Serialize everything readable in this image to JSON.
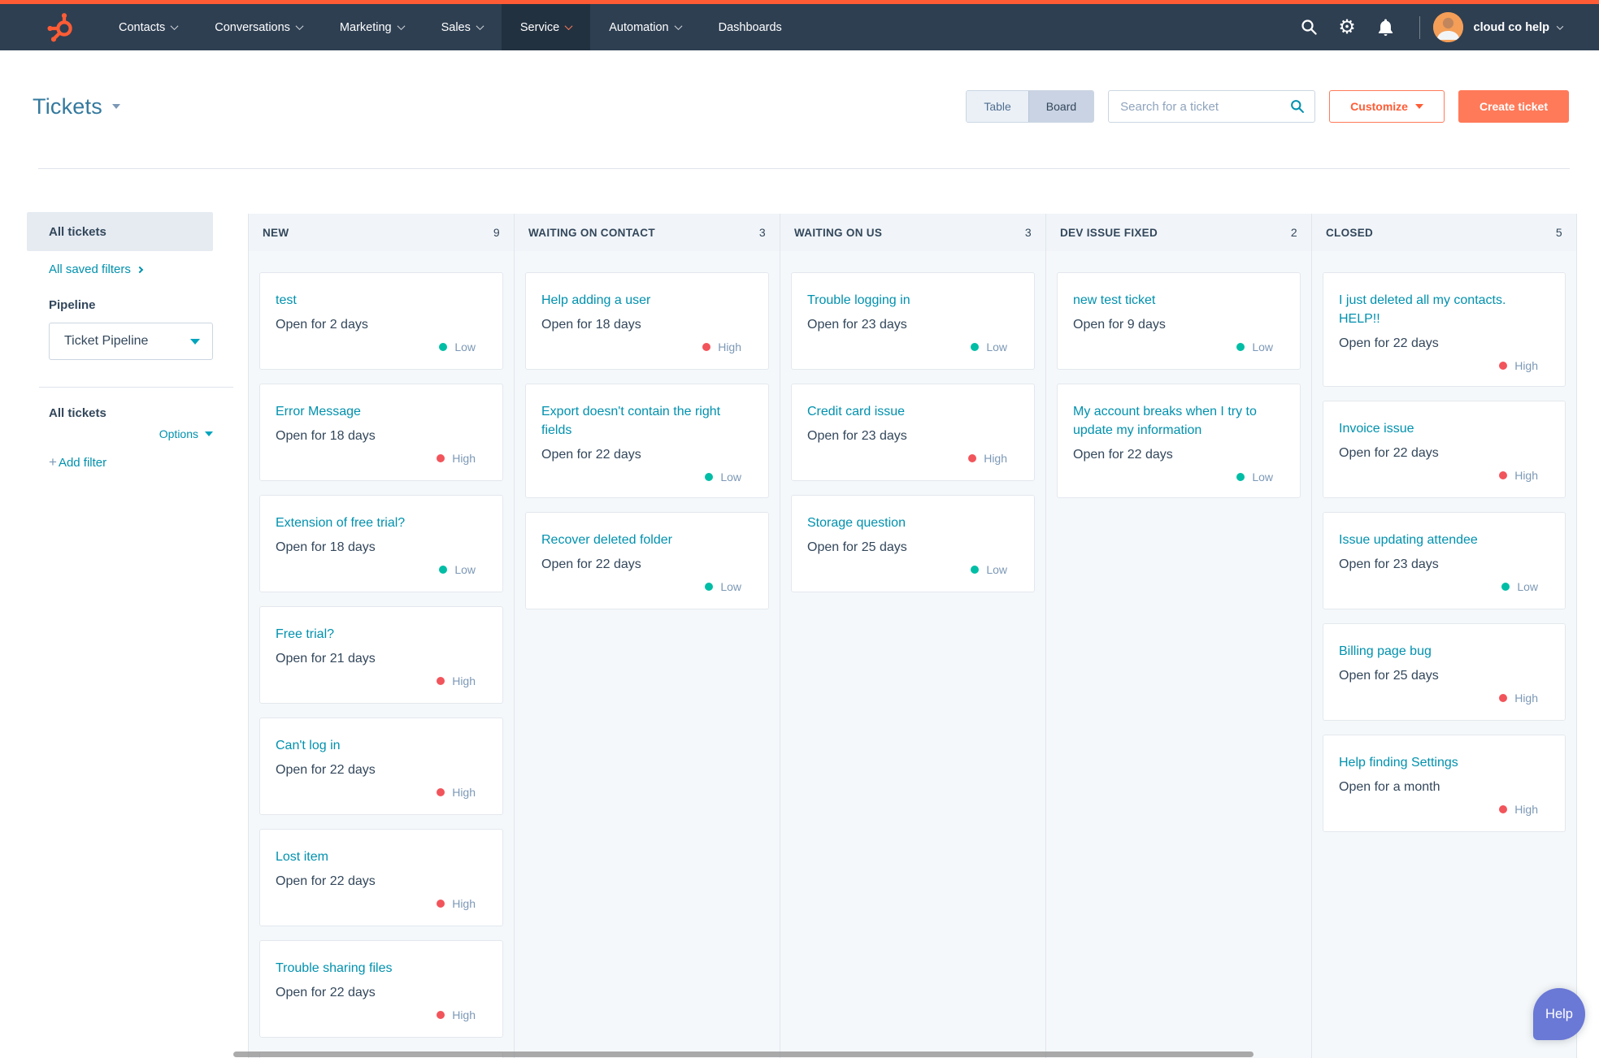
{
  "nav": {
    "items": [
      {
        "label": "Contacts",
        "caret": true,
        "active": false
      },
      {
        "label": "Conversations",
        "caret": true,
        "active": false
      },
      {
        "label": "Marketing",
        "caret": true,
        "active": false
      },
      {
        "label": "Sales",
        "caret": true,
        "active": false
      },
      {
        "label": "Service",
        "caret": true,
        "active": true
      },
      {
        "label": "Automation",
        "caret": true,
        "active": false
      },
      {
        "label": "Dashboards",
        "caret": false,
        "active": false
      }
    ],
    "account_name": "cloud co help"
  },
  "header": {
    "title": "Tickets",
    "view_toggle": {
      "table": "Table",
      "board": "Board",
      "active": "Board"
    },
    "search_placeholder": "Search for a ticket",
    "customize_label": "Customize",
    "create_label": "Create ticket"
  },
  "sidebar": {
    "selected_view": "All tickets",
    "saved_filters_link": "All saved filters",
    "pipeline_label": "Pipeline",
    "pipeline_value": "Ticket Pipeline",
    "filters_heading": "All tickets",
    "options_label": "Options",
    "add_filter_plus": "+",
    "add_filter_label": "Add filter"
  },
  "board": {
    "columns": [
      {
        "name": "NEW",
        "count": "9",
        "partial_card": true,
        "cards": [
          {
            "title": "test",
            "open_for": "Open for 2 days",
            "priority": "Low"
          },
          {
            "title": "Error Message",
            "open_for": "Open for 18 days",
            "priority": "High"
          },
          {
            "title": "Extension of free trial?",
            "open_for": "Open for 18 days",
            "priority": "Low"
          },
          {
            "title": "Free trial?",
            "open_for": "Open for 21 days",
            "priority": "High"
          },
          {
            "title": "Can't log in",
            "open_for": "Open for 22 days",
            "priority": "High"
          },
          {
            "title": "Lost item",
            "open_for": "Open for 22 days",
            "priority": "High"
          },
          {
            "title": "Trouble sharing files",
            "open_for": "Open for 22 days",
            "priority": "High"
          }
        ]
      },
      {
        "name": "WAITING ON CONTACT",
        "count": "3",
        "partial_card": false,
        "cards": [
          {
            "title": "Help adding a user",
            "open_for": "Open for 18 days",
            "priority": "High"
          },
          {
            "title": "Export doesn't contain the right fields",
            "open_for": "Open for 22 days",
            "priority": "Low"
          },
          {
            "title": "Recover deleted folder",
            "open_for": "Open for 22 days",
            "priority": "Low"
          }
        ]
      },
      {
        "name": "WAITING ON US",
        "count": "3",
        "partial_card": false,
        "cards": [
          {
            "title": "Trouble logging in",
            "open_for": "Open for 23 days",
            "priority": "Low"
          },
          {
            "title": "Credit card issue",
            "open_for": "Open for 23 days",
            "priority": "High"
          },
          {
            "title": "Storage question",
            "open_for": "Open for 25 days",
            "priority": "Low"
          }
        ]
      },
      {
        "name": "DEV ISSUE FIXED",
        "count": "2",
        "partial_card": false,
        "cards": [
          {
            "title": "new test ticket",
            "open_for": "Open for 9 days",
            "priority": "Low"
          },
          {
            "title": "My account breaks when I try to update my information",
            "open_for": "Open for 22 days",
            "priority": "Low"
          }
        ]
      },
      {
        "name": "CLOSED",
        "count": "5",
        "partial_card": false,
        "cards": [
          {
            "title": "I just deleted all my contacts. HELP!!",
            "open_for": "Open for 22 days",
            "priority": "High"
          },
          {
            "title": "Invoice issue",
            "open_for": "Open for 22 days",
            "priority": "High"
          },
          {
            "title": "Issue updating attendee",
            "open_for": "Open for 23 days",
            "priority": "Low"
          },
          {
            "title": "Billing page bug",
            "open_for": "Open for 25 days",
            "priority": "High"
          },
          {
            "title": "Help finding Settings",
            "open_for": "Open for a month",
            "priority": "High"
          }
        ]
      }
    ]
  },
  "help_button_label": "Help",
  "colors": {
    "accent_orange": "#ff5c35",
    "button_orange": "#ff7a59",
    "link_teal": "#0091ae",
    "low_green": "#00bda5",
    "high_red": "#f2545b",
    "help_purple": "#6a78d6",
    "nav_bg": "#2e3f52"
  }
}
